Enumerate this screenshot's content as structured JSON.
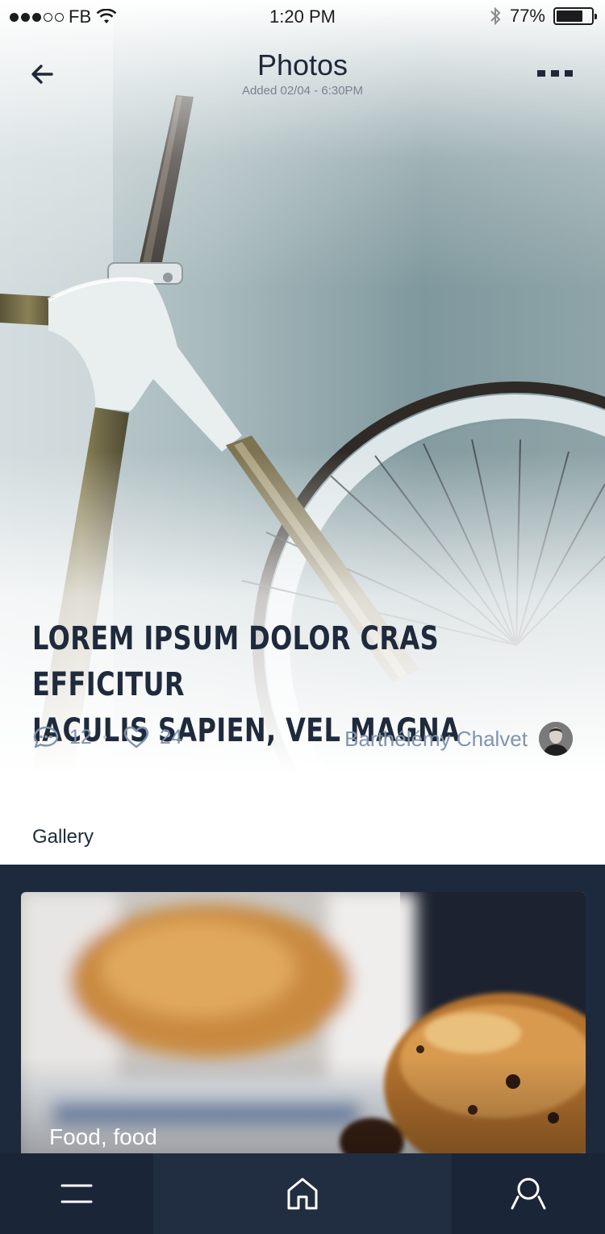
{
  "status_bar": {
    "carrier": "FB",
    "time": "1:20 PM",
    "battery": "77%",
    "battery_level": 0.77,
    "signal_icon": "signal-dots-icon",
    "wifi_icon": "wifi-icon",
    "bluetooth_icon": "bluetooth-icon"
  },
  "nav": {
    "title": "Photos",
    "subtitle": "Added 02/04 - 6:30PM",
    "back_icon": "arrow-left-icon",
    "more_icon": "more-dots-icon"
  },
  "article": {
    "title_line1": "LOREM IPSUM DOLOR CRAS EFFICITUR",
    "title_line2": "IACULIS SAPIEN, VEL MAGNA",
    "comments": "12",
    "likes": "24",
    "author": "Barthélémy Chalvet",
    "hero_image": "bicycle-photo"
  },
  "gallery": {
    "label": "Gallery",
    "items": [
      {
        "caption": "Food, food",
        "image": "pastry-photo"
      }
    ]
  },
  "tab_bar": {
    "items": [
      {
        "icon": "menu-icon"
      },
      {
        "icon": "home-icon",
        "active": true
      },
      {
        "icon": "search-icon"
      }
    ]
  },
  "colors": {
    "headline": "#1f2a3c",
    "meta": "#8193ad",
    "gallery_bg": "#1d2a3e",
    "tabbar_bg": "#1a2537",
    "tabbar_active": "#212e42"
  }
}
